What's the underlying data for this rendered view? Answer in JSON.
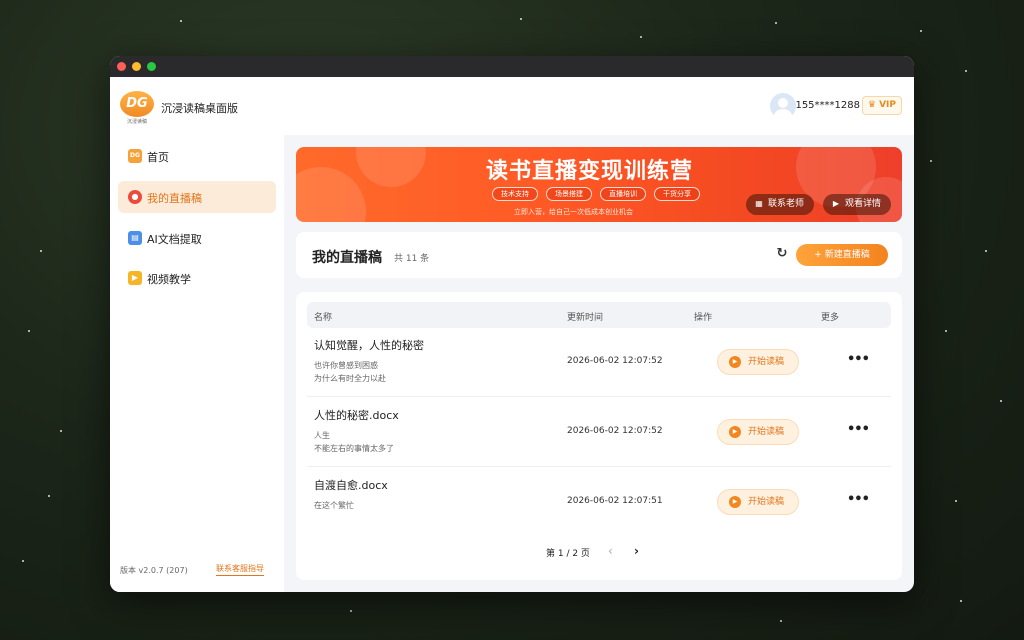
{
  "app": {
    "logo_text": "DG",
    "logo_sub": "沉浸读稿",
    "name": "沉浸读稿桌面版"
  },
  "user": {
    "phone": "155****1288",
    "vip_label": "VIP"
  },
  "sidebar": {
    "items": [
      {
        "label": "首页",
        "icon": "home-icon"
      },
      {
        "label": "我的直播稿",
        "icon": "live-icon"
      },
      {
        "label": "AI文档提取",
        "icon": "document-icon"
      },
      {
        "label": "视频教学",
        "icon": "video-icon"
      }
    ],
    "active_index": 1,
    "version": "版本 v2.0.7 (207)",
    "support_link": "联系客服指导"
  },
  "banner": {
    "title": "读书直播变现训练营",
    "tags": [
      "技术支持",
      "场景搭建",
      "直播培训",
      "干货分享"
    ],
    "subtitle": "立即入营，给自己一次低成本创业机会",
    "contact_button": "联系老师",
    "detail_button": "观看详情"
  },
  "list": {
    "title": "我的直播稿",
    "count": "共 11 条",
    "new_button": "+ 新建直播稿",
    "columns": {
      "name": "名称",
      "updated": "更新时间",
      "action": "操作",
      "more": "更多"
    },
    "action_label": "开始读稿",
    "rows": [
      {
        "name": "认知觉醒，人性的秘密",
        "line1": "也许你曾感到困惑",
        "line2": "为什么有时全力以赴",
        "time": "2026-06-02 12:07:52"
      },
      {
        "name": "人性的秘密.docx",
        "line1": "人生",
        "line2": "不能左右的事情太多了",
        "time": "2026-06-02 12:07:52"
      },
      {
        "name": "自渡自愈.docx",
        "line1": "在这个繁忙",
        "line2": "",
        "time": "2026-06-02 12:07:51"
      }
    ],
    "pager": "第 1 / 2 页"
  },
  "colors": {
    "accent": "#f3831f",
    "active_bg": "#fdebd9"
  }
}
